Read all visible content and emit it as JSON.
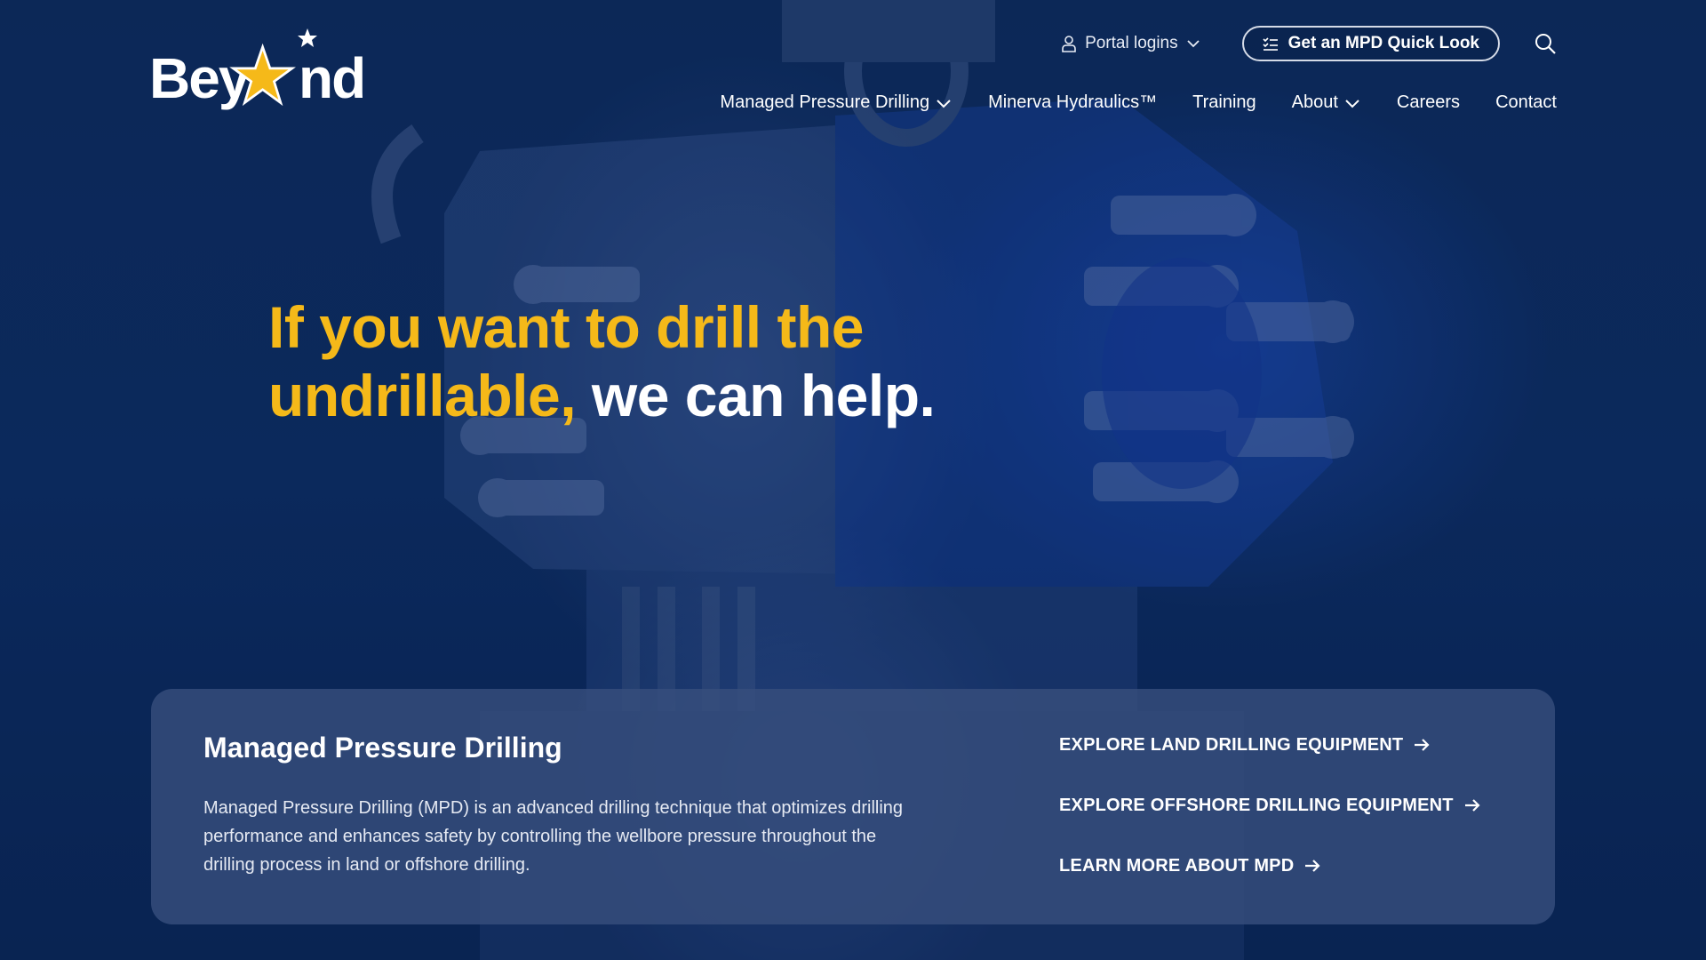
{
  "brand": {
    "logo_text": "Beyond",
    "accent_color": "#f5b919",
    "background_color": "#0c2b60"
  },
  "header": {
    "portal_label": "Portal logins",
    "quick_look_label": "Get an MPD Quick Look",
    "icons": [
      "user-icon",
      "chevron-down-icon",
      "checklist-icon",
      "search-icon"
    ]
  },
  "nav": {
    "items": [
      {
        "label": "Managed Pressure Drilling",
        "has_dropdown": true
      },
      {
        "label": "Minerva Hydraulics™",
        "has_dropdown": false
      },
      {
        "label": "Training",
        "has_dropdown": false
      },
      {
        "label": "About",
        "has_dropdown": true
      },
      {
        "label": "Careers",
        "has_dropdown": false
      },
      {
        "label": "Contact",
        "has_dropdown": false
      }
    ]
  },
  "hero": {
    "headline_accent": "If you want to drill the undrillable,",
    "headline_rest": "we can help."
  },
  "card": {
    "title": "Managed Pressure Drilling",
    "description": "Managed Pressure Drilling (MPD) is an advanced drilling technique that optimizes drilling performance and enhances safety by controlling the wellbore pressure throughout the drilling process in land or offshore drilling.",
    "links": [
      {
        "label": "EXPLORE LAND DRILLING EQUIPMENT"
      },
      {
        "label": "EXPLORE OFFSHORE DRILLING EQUIPMENT"
      },
      {
        "label": "LEARN MORE ABOUT MPD"
      }
    ]
  }
}
